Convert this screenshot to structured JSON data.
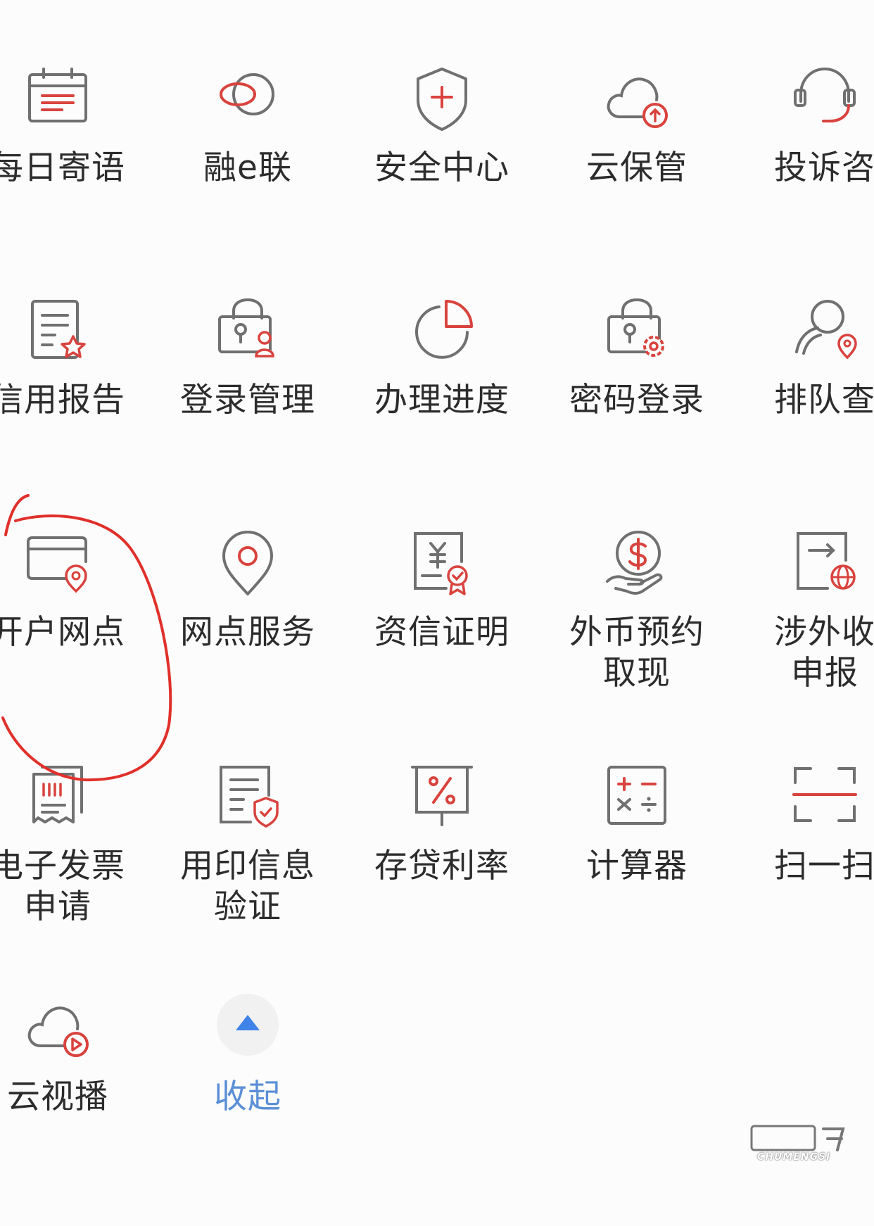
{
  "colors": {
    "accent_red": "#d9433e",
    "icon_gray": "#707070",
    "collapse_blue": "#3f82e8",
    "annotation_red": "#e0302a"
  },
  "tiles": [
    {
      "label": "每日寄语",
      "icon": "calendar-icon"
    },
    {
      "label": "融e联",
      "icon": "linked-circles-icon"
    },
    {
      "label": "安全中心",
      "icon": "shield-plus-icon"
    },
    {
      "label": "云保管",
      "icon": "cloud-upload-icon"
    },
    {
      "label": "投诉咨",
      "icon": "headset-icon"
    },
    {
      "label": "信用报告",
      "icon": "document-star-icon"
    },
    {
      "label": "登录管理",
      "icon": "lock-user-icon"
    },
    {
      "label": "办理进度",
      "icon": "pie-progress-icon"
    },
    {
      "label": "密码登录",
      "icon": "lock-gear-icon"
    },
    {
      "label": "排队查",
      "icon": "person-location-icon"
    },
    {
      "label": "开户网点",
      "icon": "card-location-icon"
    },
    {
      "label": "网点服务",
      "icon": "map-pin-icon"
    },
    {
      "label": "资信证明",
      "icon": "yuan-certificate-icon"
    },
    {
      "label": "外币预约\n取现",
      "icon": "dollar-hand-icon"
    },
    {
      "label": "涉外收\n申报",
      "icon": "document-globe-icon"
    },
    {
      "label": "电子发票\n申请",
      "icon": "invoice-icon"
    },
    {
      "label": "用印信息\n验证",
      "icon": "document-seal-icon"
    },
    {
      "label": "存贷利率",
      "icon": "percent-board-icon"
    },
    {
      "label": "计算器",
      "icon": "calculator-icon"
    },
    {
      "label": "扫一扫",
      "icon": "scan-icon"
    },
    {
      "label": "云视播",
      "icon": "cloud-play-icon"
    },
    {
      "label": "收起",
      "icon": "collapse-arrow-icon"
    }
  ],
  "watermark": {
    "text": "CHUMENGSI"
  }
}
